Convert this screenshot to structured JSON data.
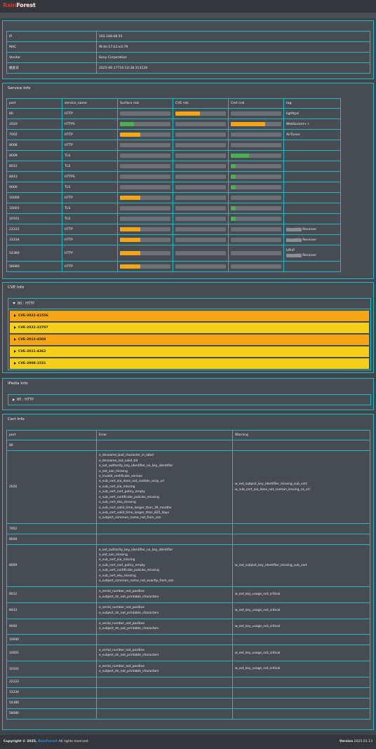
{
  "brand": {
    "part1": "Rain",
    "part2": "Forest"
  },
  "device": {
    "rows": [
      {
        "label": "IP",
        "value": "192.168.68.55"
      },
      {
        "label": "MAC",
        "value": "f8:4e:17:b1:e3:79"
      },
      {
        "label": "Vendor",
        "value": "Sony Corporation"
      },
      {
        "label": "検査日",
        "value": "2025-06-17T10:14:38.313128"
      }
    ]
  },
  "service": {
    "title": "Service Info",
    "headers": [
      "port",
      "service_name",
      "Surface risk",
      "CVE risk",
      "Cert risk",
      "tag"
    ],
    "colors": {
      "orange": "#f5a515",
      "green": "#4caf50"
    },
    "rows": [
      {
        "port": "80",
        "name": "HTTP",
        "surface": 0,
        "cve": 0.48,
        "cve_color": "orange",
        "cert": 0,
        "cert_color": "",
        "tag": "lighttpd"
      },
      {
        "port": "2020",
        "name": "HTTPS",
        "surface": 0.28,
        "surface_color": "green",
        "cve": 0,
        "cert": 0.68,
        "cert_color": "orange",
        "tag": "WebSocket++"
      },
      {
        "port": "7002",
        "name": "HTTP",
        "surface": 0.4,
        "surface_color": "orange",
        "cve": 0,
        "cert": 0,
        "tag": "AirTunes"
      },
      {
        "port": "8008",
        "name": "HTTP",
        "surface": 0,
        "cve": 0,
        "cert": 0,
        "tag": ""
      },
      {
        "port": "8009",
        "name": "TLS",
        "surface": 0,
        "cve": 0,
        "cert": 0.36,
        "cert_color": "green",
        "tag": ""
      },
      {
        "port": "8012",
        "name": "TLS",
        "surface": 0,
        "cve": 0,
        "cert": 0.1,
        "cert_color": "green",
        "tag": ""
      },
      {
        "port": "8443",
        "name": "HTTPS",
        "surface": 0,
        "cve": 0,
        "cert": 0.1,
        "cert_color": "green",
        "tag": ""
      },
      {
        "port": "9000",
        "name": "TLS",
        "surface": 0,
        "cve": 0,
        "cert": 0.1,
        "cert_color": "green",
        "tag": ""
      },
      {
        "port": "10000",
        "name": "HTTP",
        "surface": 0.4,
        "surface_color": "orange",
        "cve": 0,
        "cert": 0,
        "tag": ""
      },
      {
        "port": "10001",
        "name": "TLS",
        "surface": 0,
        "cve": 0,
        "cert": 0.1,
        "cert_color": "green",
        "tag": ""
      },
      {
        "port": "10101",
        "name": "TLS",
        "surface": 0,
        "cve": 0,
        "cert": 0.1,
        "cert_color": "green",
        "tag": ""
      },
      {
        "port": "22222",
        "name": "HTTP",
        "surface": 0.4,
        "surface_color": "orange",
        "cve": 0,
        "cert": 0,
        "tag_blur": "Sony STR",
        "tag": "Receiver"
      },
      {
        "port": "33334",
        "name": "HTTP",
        "surface": 0.4,
        "surface_color": "orange",
        "cve": 0,
        "cert": 0,
        "tag_blur": "Sony STR",
        "tag": "Receiver"
      },
      {
        "port": "54380",
        "name": "HTTP",
        "surface": 0.4,
        "surface_color": "orange",
        "cve": 0,
        "cert": 0,
        "tag_top": "UPnP",
        "tag_blur": "Sony STR",
        "tag": "Receiver"
      },
      {
        "port": "58080",
        "name": "HTTP",
        "surface": 0.4,
        "surface_color": "orange",
        "cve": 0,
        "cert": 0,
        "tag": ""
      }
    ]
  },
  "cve": {
    "title": "CVE Info",
    "group": "80 : HTTP",
    "items": [
      {
        "id": "CVE-2022-41556",
        "color": "#f5a515"
      },
      {
        "id": "CVE-2022-22707",
        "color": "#f5cf1a"
      },
      {
        "id": "CVE-2013-4508",
        "color": "#f5a515"
      },
      {
        "id": "CVE-2011-4362",
        "color": "#f5cf1a"
      },
      {
        "id": "CVE-2008-1531",
        "color": "#f5cf1a"
      }
    ]
  },
  "ipedia": {
    "title": "IPedia Info",
    "item": "80 : HTTP"
  },
  "cert": {
    "title": "Cert Info",
    "headers": [
      "port",
      "Error",
      "Warning"
    ],
    "rows": [
      {
        "port": "80",
        "errors": [],
        "warnings": []
      },
      {
        "port": "2020",
        "errors": [
          "e_dnsname_bad_character_in_label",
          "e_dnsname_not_valid_tld",
          "e_ext_authority_key_identifier_no_key_identifier",
          "e_ext_san_missing",
          "e_invalid_certificate_version",
          "e_sub_cert_aia_does_not_contain_ocsp_url",
          "e_sub_cert_aia_missing",
          "e_sub_cert_cert_policy_empty",
          "e_sub_cert_certificate_policies_missing",
          "e_sub_cert_eku_missing",
          "e_sub_cert_valid_time_longer_than_39_months",
          "e_sub_cert_valid_time_longer_than_825_days",
          "e_subject_common_name_not_from_san"
        ],
        "warnings": [
          "w_ext_subject_key_identifier_missing_sub_cert",
          "w_sub_cert_aia_does_not_contain_issuing_ca_url"
        ]
      },
      {
        "port": "7002",
        "errors": [],
        "warnings": []
      },
      {
        "port": "8008",
        "errors": [],
        "warnings": []
      },
      {
        "port": "8009",
        "errors": [
          "e_ext_authority_key_identifier_no_key_identifier",
          "e_ext_san_missing",
          "e_sub_cert_aia_missing",
          "e_sub_cert_cert_policy_empty",
          "e_sub_cert_certificate_policies_missing",
          "e_sub_cert_eku_missing",
          "e_subject_common_name_not_exactly_from_san"
        ],
        "warnings": [
          "w_ext_subject_key_identifier_missing_sub_cert"
        ]
      },
      {
        "port": "8012",
        "errors": [
          "e_serial_number_not_positive",
          "e_subject_dn_not_printable_characters"
        ],
        "warnings": [
          "w_ext_key_usage_not_critical"
        ]
      },
      {
        "port": "8443",
        "errors": [
          "e_serial_number_not_positive",
          "e_subject_dn_not_printable_characters"
        ],
        "warnings": [
          "w_ext_key_usage_not_critical"
        ]
      },
      {
        "port": "9000",
        "errors": [
          "e_serial_number_not_positive",
          "e_subject_dn_not_printable_characters"
        ],
        "warnings": [
          "w_ext_key_usage_not_critical"
        ]
      },
      {
        "port": "10000",
        "errors": [],
        "warnings": []
      },
      {
        "port": "10001",
        "errors": [
          "e_serial_number_not_positive",
          "e_subject_dn_not_printable_characters"
        ],
        "warnings": [
          "w_ext_key_usage_not_critical"
        ]
      },
      {
        "port": "10101",
        "errors": [
          "e_serial_number_not_positive",
          "e_subject_dn_not_printable_characters"
        ],
        "warnings": [
          "w_ext_key_usage_not_critical"
        ]
      },
      {
        "port": "22222",
        "errors": [],
        "warnings": []
      },
      {
        "port": "33334",
        "errors": [],
        "warnings": []
      },
      {
        "port": "54380",
        "errors": [],
        "warnings": []
      },
      {
        "port": "58080",
        "errors": [],
        "warnings": []
      }
    ]
  },
  "footer": {
    "copyright": "Copyright © 2025,",
    "brand": "RainForest",
    "rights": "All rights reserved.",
    "version_label": "Version",
    "version": "2025.01.13"
  }
}
